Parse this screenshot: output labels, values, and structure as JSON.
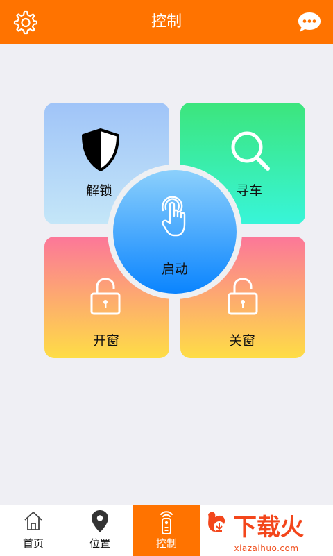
{
  "header": {
    "title": "控制",
    "settings_icon": "gear-icon",
    "message_icon": "chat-bubble-icon",
    "bg_color": "#ff7300"
  },
  "tiles": [
    {
      "label": "解锁",
      "icon": "shield-icon"
    },
    {
      "label": "寻车",
      "icon": "search-icon"
    },
    {
      "label": "开窗",
      "icon": "padlock-icon"
    },
    {
      "label": "关窗",
      "icon": "padlock-icon"
    }
  ],
  "center": {
    "label": "启动",
    "icon": "touch-finger-icon"
  },
  "tabbar": {
    "tabs": [
      {
        "label": "首页",
        "icon": "home-icon"
      },
      {
        "label": "位置",
        "icon": "location-pin-icon"
      },
      {
        "label": "控制",
        "icon": "remote-control-icon",
        "active": true
      }
    ]
  },
  "ad": {
    "logo_text": "下载火",
    "url": "xiazaihuo.com"
  }
}
